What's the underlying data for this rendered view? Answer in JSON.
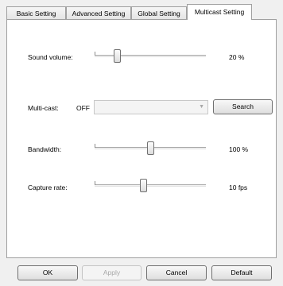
{
  "tabs": [
    "Basic Setting",
    "Advanced Setting",
    "Global Setting",
    "Multicast Setting"
  ],
  "active_tab": "Multicast Setting",
  "sound_volume": {
    "label": "Sound volume:",
    "value_text": "20 %",
    "level": 0.2
  },
  "multicast": {
    "label": "Multi-cast:",
    "state": "OFF",
    "combo_value": "",
    "search_label": "Search"
  },
  "bandwidth": {
    "label": "Bandwidth:",
    "value_text": "100 %",
    "level": 0.5
  },
  "capture_rate": {
    "label": "Capture rate:",
    "value_text": "10 fps",
    "level": 0.44
  },
  "buttons": {
    "ok": "OK",
    "apply": "Apply",
    "cancel": "Cancel",
    "default": "Default"
  },
  "icons": {
    "combo_arrow": "chevron-down-icon"
  }
}
